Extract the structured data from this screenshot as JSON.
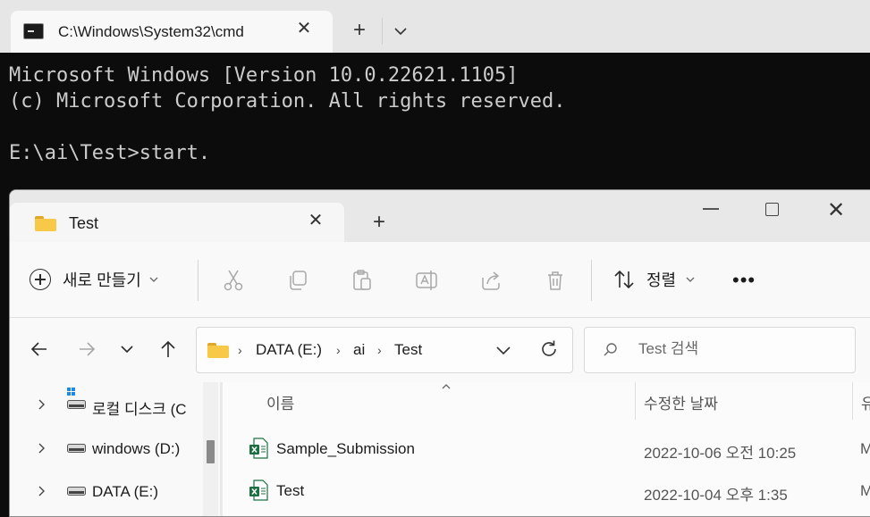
{
  "terminal": {
    "tab_title": "C:\\Windows\\System32\\cmd",
    "lines": [
      "Microsoft Windows [Version 10.0.22621.1105]",
      "(c) Microsoft Corporation. All rights reserved.",
      "",
      "E:\\ai\\Test>start."
    ]
  },
  "explorer": {
    "tab_title": "Test",
    "command_bar": {
      "new_label": "새로 만들기",
      "sort_label": "정렬",
      "more_label": "•••"
    },
    "address": {
      "crumbs": [
        "DATA (E:)",
        "ai",
        "Test"
      ]
    },
    "search": {
      "placeholder": "Test 검색"
    },
    "nav_items": [
      {
        "label": "로컬 디스크 (C",
        "icon": "system-drive-icon"
      },
      {
        "label": "windows (D:)",
        "icon": "drive-icon"
      },
      {
        "label": "DATA (E:)",
        "icon": "drive-icon"
      }
    ],
    "columns": {
      "name": "이름",
      "modified": "수정한 날짜",
      "type_trunc": "유"
    },
    "files": [
      {
        "name": "Sample_Submission",
        "modified": "2022-10-06 오전 10:25",
        "type_trunc": "M",
        "icon": "excel-icon"
      },
      {
        "name": "Test",
        "modified": "2022-10-04 오후 1:35",
        "type_trunc": "M",
        "icon": "excel-icon"
      }
    ]
  },
  "colors": {
    "terminal_bg": "#0c0c0c",
    "terminal_text": "#cccccc",
    "folder_yellow": "#f8c848",
    "excel_green": "#1d6f42"
  }
}
